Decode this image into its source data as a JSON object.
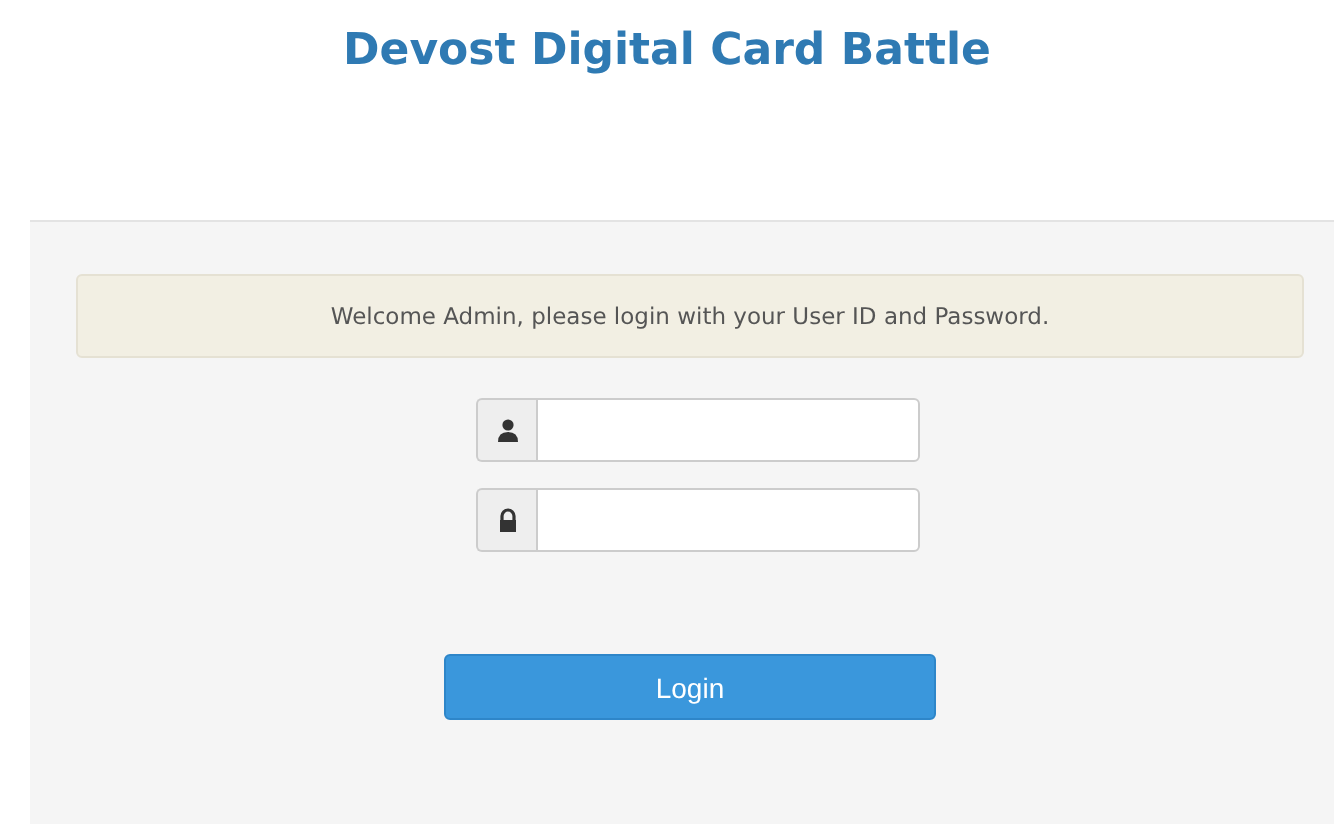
{
  "title": "Devost Digital Card Battle",
  "message": "Welcome Admin, please login with your User ID and Password.",
  "fields": [
    {
      "kind": "user"
    },
    {
      "kind": "password"
    }
  ],
  "button": "Login"
}
